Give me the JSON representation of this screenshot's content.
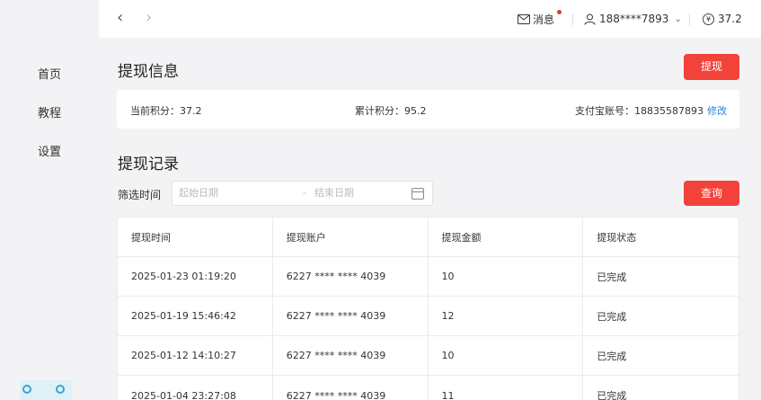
{
  "sidebar": {
    "items": [
      {
        "label": "首页"
      },
      {
        "label": "教程"
      },
      {
        "label": "设置"
      }
    ]
  },
  "topbar": {
    "back_icon": "chevron-left-icon",
    "forward_icon": "chevron-right-icon",
    "messages_label": "消息",
    "user_label": "188****7893",
    "balance_label": "37.2"
  },
  "info": {
    "title": "提现信息",
    "withdraw_button": "提现",
    "current_points": "当前积分：37.2",
    "total_points": "累计积分：95.2",
    "alipay_account": "支付宝账号：18835587893",
    "edit_link": "修改"
  },
  "records": {
    "title": "提现记录",
    "filter_label": "筛选时间",
    "start_placeholder": "起始日期",
    "end_placeholder": "结束日期",
    "date_separator": "-",
    "query_button": "查询",
    "columns": [
      "提现时间",
      "提现账户",
      "提现金额",
      "提现状态"
    ],
    "rows": [
      [
        "2025-01-23 01:19:20",
        "6227 **** **** 4039",
        "10",
        "已完成"
      ],
      [
        "2025-01-19 15:46:42",
        "6227 **** **** 4039",
        "12",
        "已完成"
      ],
      [
        "2025-01-12 14:10:27",
        "6227 **** **** 4039",
        "10",
        "已完成"
      ],
      [
        "2025-01-04 23:27:08",
        "6227 **** **** 4039",
        "11",
        "已完成"
      ]
    ]
  },
  "colors": {
    "accent_red": "#f2423a",
    "link_blue": "#2d7fd8",
    "page_bg": "#f3f3f5"
  }
}
